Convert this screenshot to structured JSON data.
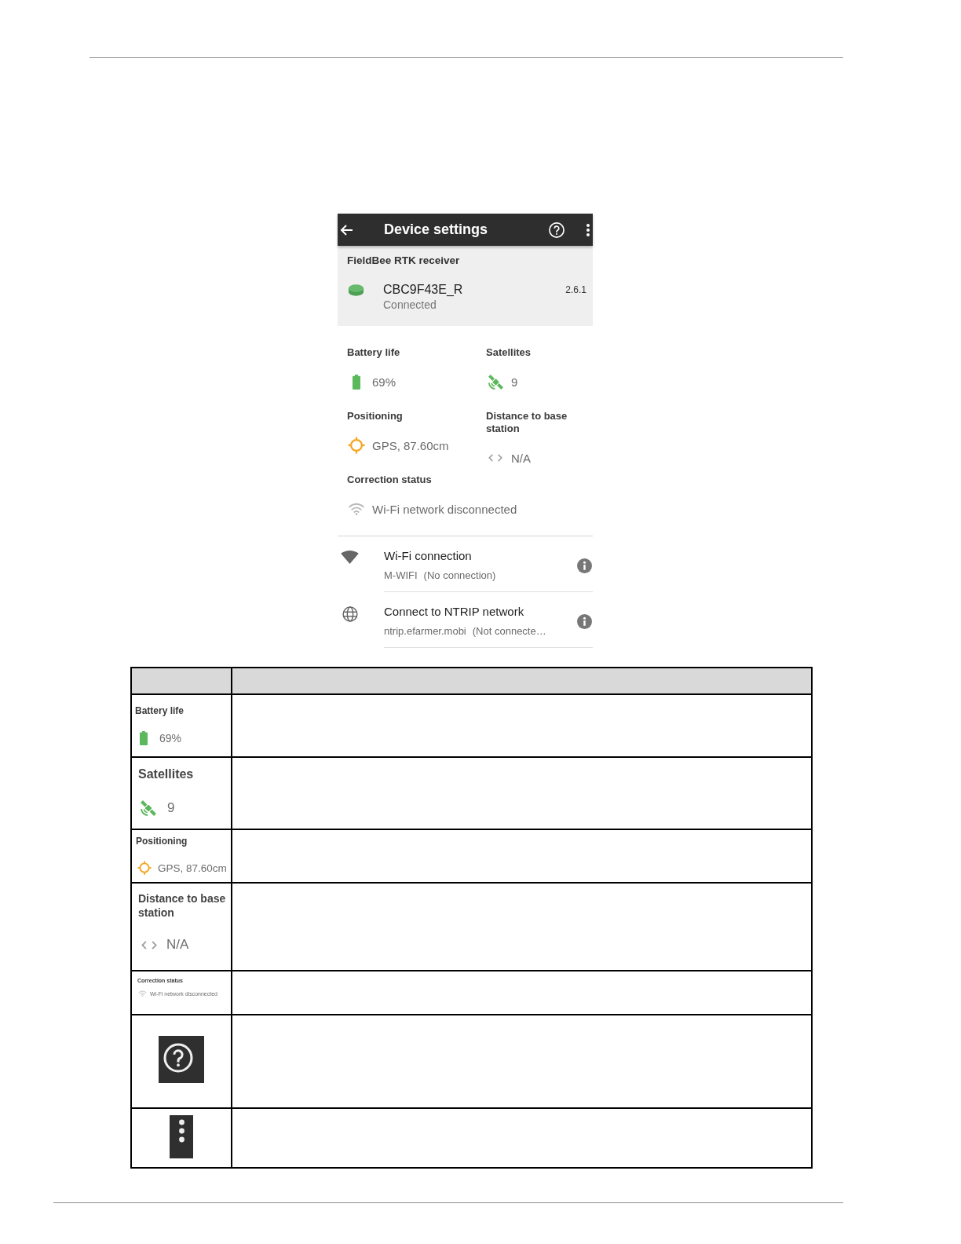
{
  "device_screen": {
    "app_bar": {
      "title": "Device settings"
    },
    "receiver": {
      "section_title": "FieldBee RTK receiver",
      "device_name": "CBC9F43E_R",
      "status": "Connected",
      "version": "2.6.1"
    },
    "stats": [
      {
        "kind": "battery",
        "label": "Battery life",
        "value": "69%"
      },
      {
        "kind": "satellites",
        "label": "Satellites",
        "value": "9"
      },
      {
        "kind": "positioning",
        "label": "Positioning",
        "value": "GPS, 87.60cm"
      },
      {
        "kind": "distance",
        "label": "Distance to base station",
        "value": "N/A"
      },
      {
        "kind": "correction",
        "label": "Correction status",
        "value": "Wi-Fi network disconnected"
      }
    ],
    "connections": [
      {
        "kind": "wifi",
        "title": "Wi-Fi connection",
        "network": "M-WIFI",
        "state": "(No connection)"
      },
      {
        "kind": "ntrip",
        "title": "Connect to NTRIP network",
        "network": "ntrip.efarmer.mobi",
        "state": "(Not connecte…"
      }
    ]
  },
  "legend_table": {
    "rows": [
      {
        "kind": "battery",
        "label": "Battery life",
        "value": "69%"
      },
      {
        "kind": "satellites",
        "label": "Satellites",
        "value": "9"
      },
      {
        "kind": "positioning",
        "label": "Positioning",
        "value": "GPS, 87.60cm"
      },
      {
        "kind": "distance",
        "label": "Distance to base station",
        "value": "N/A"
      },
      {
        "kind": "correction",
        "label": "Correction status",
        "value": "Wi-Fi network disconnected"
      },
      {
        "kind": "help_button"
      },
      {
        "kind": "menu_button"
      }
    ]
  }
}
